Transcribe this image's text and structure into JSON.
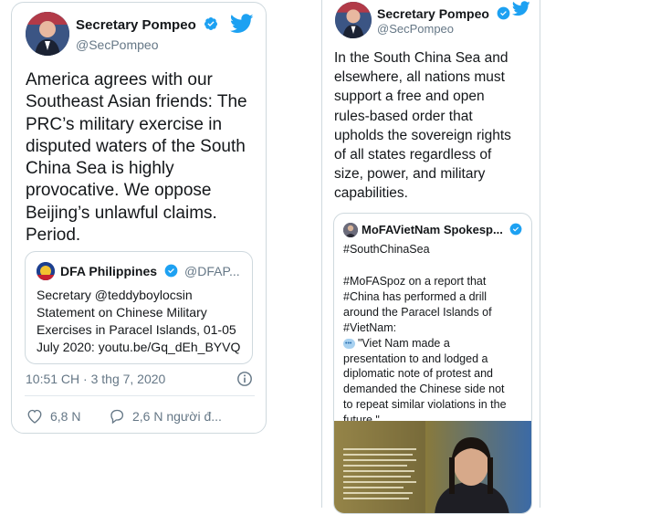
{
  "tweet1": {
    "author_name": "Secretary Pompeo",
    "author_handle": "@SecPompeo",
    "text_lines": [
      "America agrees with  our",
      "Southeast Asian friends:  The",
      "PRC’s military exercise in",
      "disputed waters of the South",
      "China Sea is highly",
      "provocative. We oppose",
      "Beijing’s unlawful claims.",
      "Period."
    ],
    "quote": {
      "author_name": "DFA Philippines",
      "author_handle": "@DFAP...",
      "text_lines": [
        "Secretary @teddyboylocsin",
        "Statement on Chinese Military",
        "Exercises in Paracel Islands, 01-05",
        "July 2020: youtu.be/Gq_dEh_BYVQ"
      ]
    },
    "timestamp": "10:51 CH · 3 thg 7, 2020",
    "likes": "6,8 N",
    "replies": "2,6 N người đ..."
  },
  "tweet2": {
    "author_name": "Secretary Pompeo",
    "author_handle": "@SecPompeo",
    "text_lines": [
      "In the South China Sea and",
      "elsewhere, all nations must",
      "support a free and open",
      "rules-based order that",
      "upholds the sovereign rights",
      "of all states regardless of",
      "size, power, and military",
      "capabilities."
    ],
    "quote": {
      "author_name": "MoFAVietNam Spokesp...",
      "hashtag": "#SouthChinaSea",
      "body_lines": [
        "#MoFASpoz on a report that",
        "#China has performed a drill",
        "around the Paracel Islands of",
        "#VietNam:",
        "\"Viet Nam made a",
        "presentation to and lodged a",
        "diplomatic note of protest and",
        "demanded the Chinese side not",
        "to repeat similar violations in the",
        "future.\""
      ]
    }
  },
  "colors": {
    "twitter_blue": "#1da1f2",
    "text": "#14171a",
    "muted": "#657786",
    "border": "#cfd9de"
  },
  "icons": [
    "twitter-bird-icon",
    "verified-badge-icon",
    "info-icon",
    "heart-icon",
    "reply-icon",
    "speech-balloon-emoji"
  ]
}
